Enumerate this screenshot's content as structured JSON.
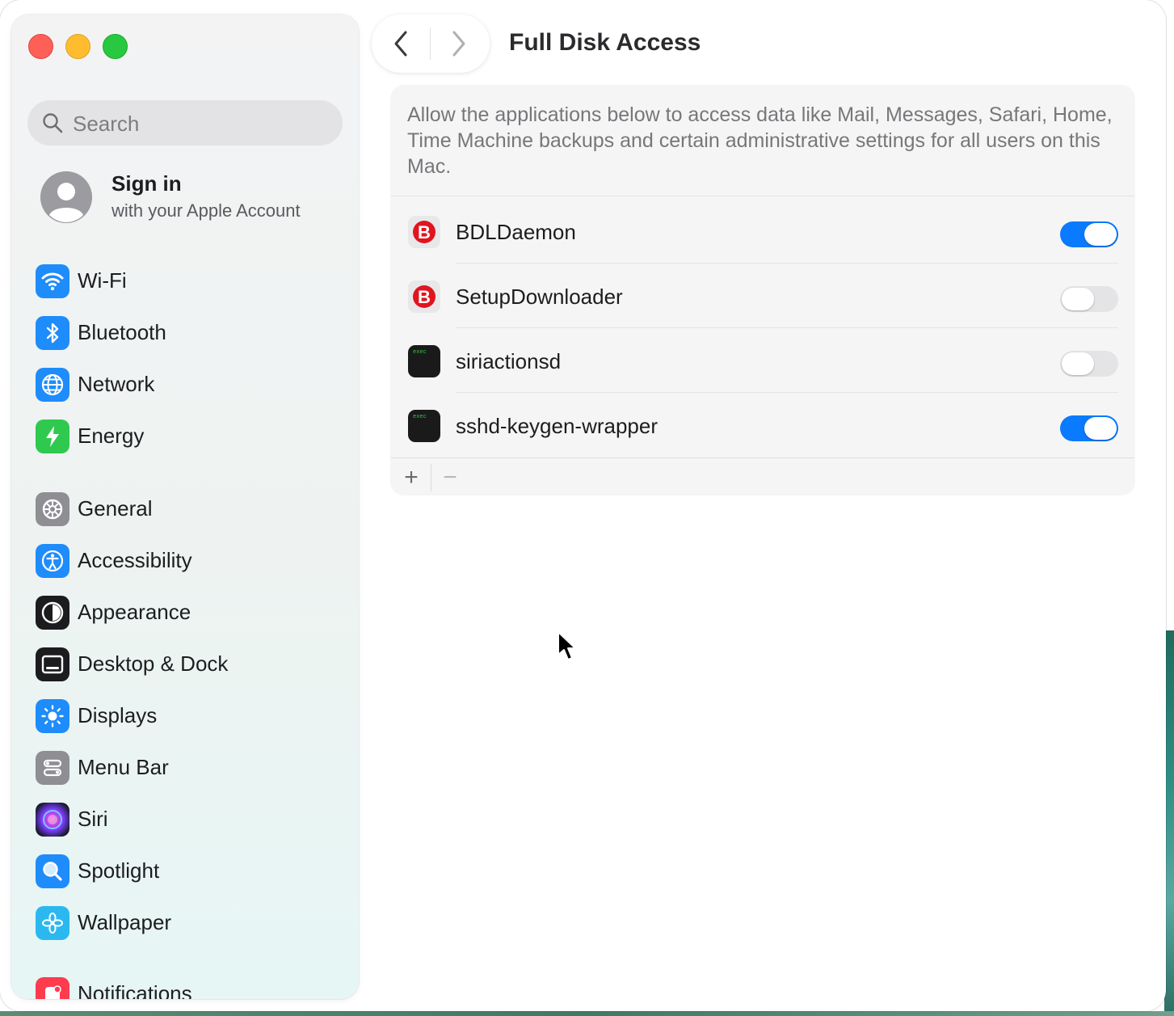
{
  "window": {
    "title": "Full Disk Access"
  },
  "sidebar": {
    "search_placeholder": "Search",
    "account": {
      "title": "Sign in",
      "subtitle": "with your Apple Account"
    },
    "items": [
      {
        "label": "Wi-Fi",
        "icon": "wifi-icon"
      },
      {
        "label": "Bluetooth",
        "icon": "bluetooth-icon"
      },
      {
        "label": "Network",
        "icon": "globe-icon"
      },
      {
        "label": "Energy",
        "icon": "bolt-icon"
      },
      {
        "label": "General",
        "icon": "gear-icon"
      },
      {
        "label": "Accessibility",
        "icon": "accessibility-icon"
      },
      {
        "label": "Appearance",
        "icon": "appearance-icon"
      },
      {
        "label": "Desktop & Dock",
        "icon": "dock-icon"
      },
      {
        "label": "Displays",
        "icon": "sun-icon"
      },
      {
        "label": "Menu Bar",
        "icon": "menubar-icon"
      },
      {
        "label": "Siri",
        "icon": "siri-icon"
      },
      {
        "label": "Spotlight",
        "icon": "magnifier-icon"
      },
      {
        "label": "Wallpaper",
        "icon": "flower-icon"
      },
      {
        "label": "Notifications",
        "icon": "bell-icon"
      }
    ]
  },
  "main": {
    "description": "Allow the applications below to access data like Mail, Messages, Safari, Home, Time Machine backups and certain administrative settings for all users on this Mac.",
    "apps": [
      {
        "name": "BDLDaemon",
        "icon": "bitdefender-icon",
        "enabled": true
      },
      {
        "name": "SetupDownloader",
        "icon": "bitdefender-icon",
        "enabled": false
      },
      {
        "name": "siriactionsd",
        "icon": "exec-icon",
        "enabled": false
      },
      {
        "name": "sshd-keygen-wrapper",
        "icon": "exec-icon",
        "enabled": true
      }
    ],
    "add_label": "+",
    "remove_label": "−",
    "exec_icon_text": "exec",
    "bitdefender_letter": "B"
  },
  "colors": {
    "accent": "#0a7aff",
    "close": "#fe5f57",
    "minimize": "#febc2e",
    "maximize": "#28c840"
  }
}
